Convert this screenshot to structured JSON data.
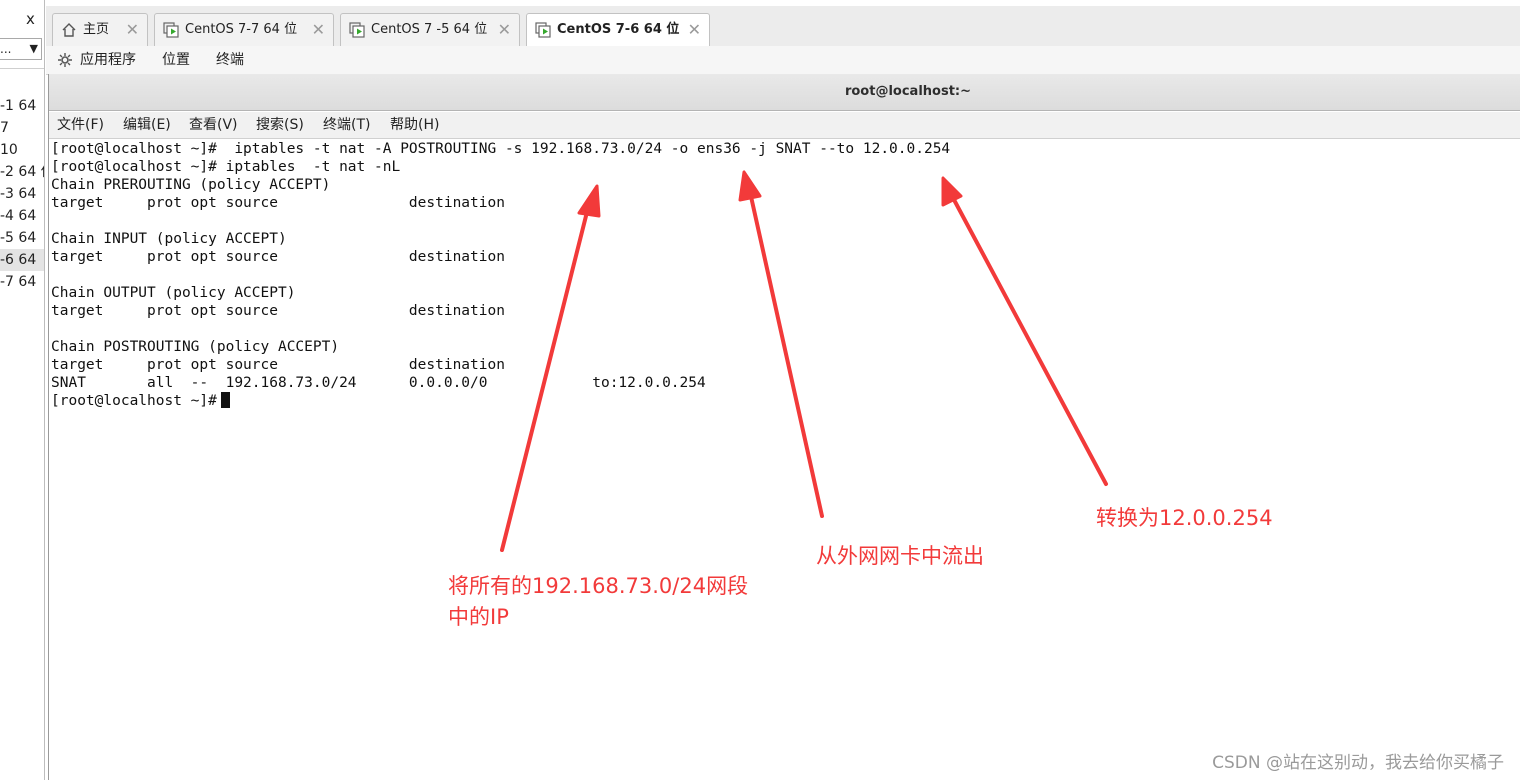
{
  "left_panel": {
    "close_symbol": "x",
    "dropdown_text": "...",
    "vm_items": [
      "-1 64",
      "7",
      "10",
      "-2 64 位",
      "-3 64",
      "-4 64",
      "-5 64",
      "-6 64",
      "-7 64"
    ],
    "selected_index": 7
  },
  "tabs": [
    {
      "label": "主页",
      "icon": "home-icon",
      "active": false
    },
    {
      "label": "CentOS 7-7  64 位",
      "icon": "vm-icon",
      "active": false
    },
    {
      "label": "CentOS 7 -5 64 位",
      "icon": "vm-icon",
      "active": false
    },
    {
      "label": "CentOS 7-6   64 位",
      "icon": "vm-icon",
      "active": true
    }
  ],
  "tab_close_symbol": "✕",
  "desktop_menu": [
    "应用程序",
    "位置",
    "终端"
  ],
  "terminal": {
    "title": "root@localhost:~",
    "menu": [
      "文件(F)",
      "编辑(E)",
      "查看(V)",
      "搜索(S)",
      "终端(T)",
      "帮助(H)"
    ],
    "lines": [
      "[root@localhost ~]#  iptables -t nat -A POSTROUTING -s 192.168.73.0/24 -o ens36 -j SNAT --to 12.0.0.254",
      "[root@localhost ~]# iptables  -t nat -nL",
      "Chain PREROUTING (policy ACCEPT)",
      "target     prot opt source               destination",
      "",
      "Chain INPUT (policy ACCEPT)",
      "target     prot opt source               destination",
      "",
      "Chain OUTPUT (policy ACCEPT)",
      "target     prot opt source               destination",
      "",
      "Chain POSTROUTING (policy ACCEPT)",
      "target     prot opt source               destination",
      "SNAT       all  --  192.168.73.0/24      0.0.0.0/0            to:12.0.0.254",
      "[root@localhost ~]#"
    ]
  },
  "annotations": {
    "source_line1": "将所有的192.168.73.0/24网段",
    "source_line2": "中的IP",
    "out_iface": "从外网网卡中流出",
    "to_addr": "转换为12.0.0.254",
    "color": "#f23a3a"
  },
  "watermark": "CSDN @站在这别动，我去给你买橘子"
}
